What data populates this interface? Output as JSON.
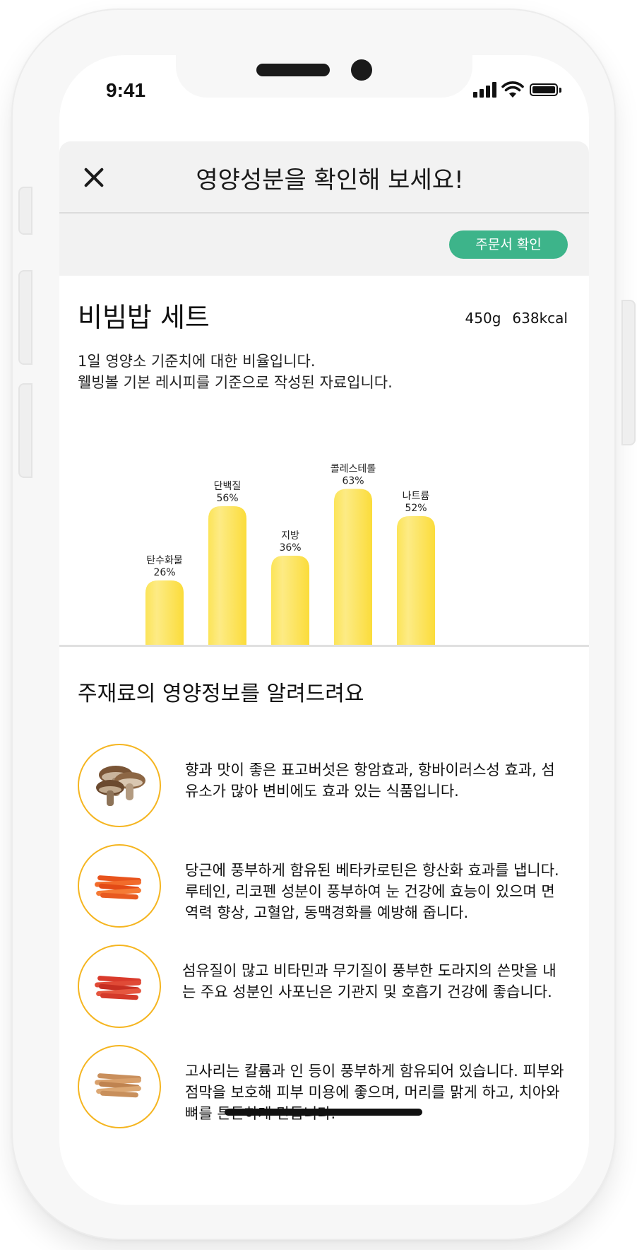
{
  "status_bar": {
    "time": "9:41"
  },
  "header": {
    "title": "영양성분을 확인해 보세요!"
  },
  "order_button": {
    "label": "주문서 확인"
  },
  "dish": {
    "name": "비빔밥 세트",
    "weight": "450g",
    "calories": "638kcal",
    "description_line1": "1일 영양소 기준치에 대한 비율입니다.",
    "description_line2": "웰빙볼 기본 레시피를 기준으로 작성된 자료입니다."
  },
  "chart_data": {
    "type": "bar",
    "categories": [
      "탄수화물",
      "단백질",
      "지방",
      "콜레스테롤",
      "나트륨"
    ],
    "values": [
      26,
      56,
      36,
      63,
      52
    ],
    "value_labels": [
      "26%",
      "56%",
      "36%",
      "63%",
      "52%"
    ],
    "unit": "%",
    "ylim": [
      0,
      100
    ],
    "grid": false,
    "bar_color": "#fde76a",
    "bar_edge_color": "#fbd72b"
  },
  "ingredients": {
    "title": "주재료의 영양정보를 알려드려요",
    "items": [
      {
        "icon": "mushroom-icon",
        "text": "향과 맛이 좋은 표고버섯은 항암효과, 항바이러스성 효과, 섬유소가 많아 변비에도 효과 있는 식품입니다."
      },
      {
        "icon": "carrot-icon",
        "text": "당근에 풍부하게 함유된 베타카로틴은 항산화 효과를 냅니다. 루테인, 리코펜 성분이 풍부하여 눈 건강에 효능이 있으며 면역력 향상, 고혈압, 동맥경화를 예방해 줍니다."
      },
      {
        "icon": "bellflower-root-icon",
        "text": "섬유질이 많고 비타민과 무기질이 풍부한 도라지의 쓴맛을 내는 주요 성분인 사포닌은 기관지 및 호흡기 건강에 좋습니다."
      },
      {
        "icon": "bracken-icon",
        "text": "고사리는 칼륨과 인 등이 풍부하게 함유되어 있습니다. 피부와 점막을 보호해 피부 미용에 좋으며, 머리를 맑게 하고, 치아와 뼈를 튼튼하게 만듭니다."
      }
    ]
  },
  "colors": {
    "accent": "#3db48a",
    "ring": "#f5b520",
    "bar": "#fde76a"
  }
}
